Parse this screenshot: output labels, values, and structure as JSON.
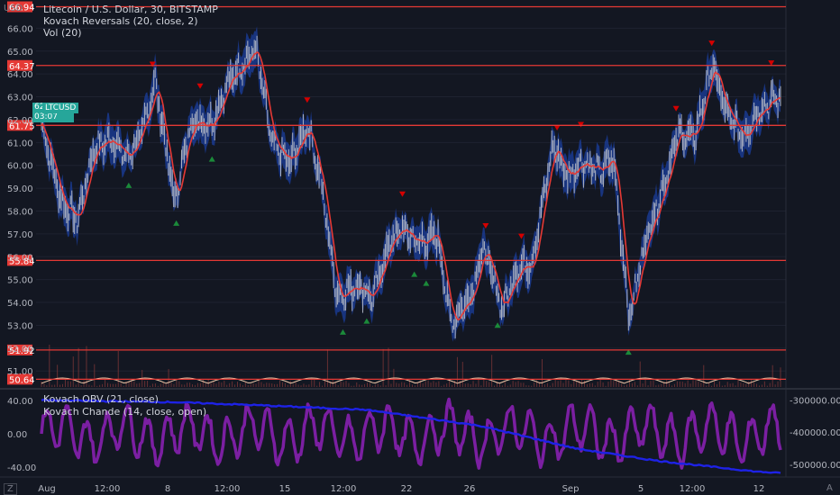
{
  "header": {
    "title": "Litecoin / U.S. Dollar, 30, BITSTAMP",
    "indicator1": "Kovach Reversals (20, close, 2)",
    "indicator2": "Vol (20)",
    "lower_indicator1": "Kovach OBV (21, close)",
    "lower_indicator2": "Kovach Chande (14, close, open)"
  },
  "axis_unit": "USD",
  "last_price": {
    "value": "62.89",
    "countdown": "03:07",
    "symbol": "LTCUSD"
  },
  "corner_left": "Z",
  "corner_right": "A",
  "colors": {
    "background": "#131722",
    "level": "#e53935",
    "up_marker": "#1b8a3a",
    "down_marker": "#d50000",
    "chande": "#7b1fa2",
    "obv": "#1e22e6",
    "band": "#1a3a8f",
    "price": "#d3d3d3"
  },
  "chart_data": [
    {
      "type": "line",
      "title": "Litecoin / U.S. Dollar, 30, BITSTAMP",
      "ylabel": "USD",
      "ylim": [
        50.3,
        67.0
      ],
      "y_ticks": [
        "66.00",
        "65.00",
        "64.00",
        "63.00",
        "62.00",
        "61.00",
        "60.00",
        "59.00",
        "58.00",
        "57.00",
        "56.00",
        "55.00",
        "54.00",
        "53.00",
        "52.00",
        "51.00"
      ],
      "x_ticks": [
        "Aug",
        "12:00",
        "8",
        "12:00",
        "15",
        "12:00",
        "22",
        "26",
        "Sep",
        "5",
        "12:00",
        "12"
      ],
      "levels": [
        "66.94",
        "64.37",
        "61.75",
        "55.84",
        "51.92",
        "50.64"
      ],
      "anchors_day": [
        0,
        1.2,
        2.2,
        3.2,
        4.4,
        5.2,
        6.2,
        7.0,
        8.2,
        9.2,
        10.5,
        11.4,
        12.3,
        13.2,
        14.2,
        15.3,
        16.4,
        17.2,
        18.2,
        19.5,
        20.4,
        21.4,
        22.2,
        23.2,
        24.4,
        25.2,
        26.4,
        27.2,
        28.4,
        29.2,
        30.2,
        31.5,
        32.4,
        33.2,
        34.4,
        35.2,
        36.2,
        37.2,
        38.2,
        39.2,
        40.2,
        41.3,
        42.2,
        43.2,
        44.2,
        45.2
      ],
      "anchors_price": [
        61.8,
        58.5,
        57.6,
        60.7,
        61.2,
        60.3,
        61.4,
        63.7,
        58.4,
        61.9,
        61.9,
        63.5,
        64.4,
        65.1,
        60.9,
        60.1,
        61.8,
        59.3,
        54.3,
        54.8,
        54.2,
        56.6,
        57.2,
        56.6,
        56.9,
        53.1,
        54.3,
        56.4,
        53.7,
        55.4,
        55.8,
        60.9,
        59.5,
        60.2,
        59.7,
        60.3,
        53.3,
        56.8,
        58.9,
        61.4,
        61.2,
        64.4,
        62.2,
        61.3,
        62.5,
        62.9
      ],
      "volume_ylim": [
        0,
        100
      ]
    },
    {
      "type": "line",
      "y_ticks_left": [
        "40.00",
        "0.00",
        "-40.00"
      ],
      "ylim": [
        -52,
        52
      ],
      "y_ticks_right": [
        "-300000.00",
        "-400000.00",
        "-500000.00"
      ],
      "obv_ylim": [
        -540000,
        -270000
      ],
      "obv_anchors_day": [
        0,
        8,
        13,
        20,
        27,
        33,
        38,
        44,
        45.5
      ],
      "obv_anchors": [
        -300000,
        -306000,
        -315000,
        -330000,
        -380000,
        -452000,
        -490000,
        -523000,
        -528000
      ]
    }
  ]
}
